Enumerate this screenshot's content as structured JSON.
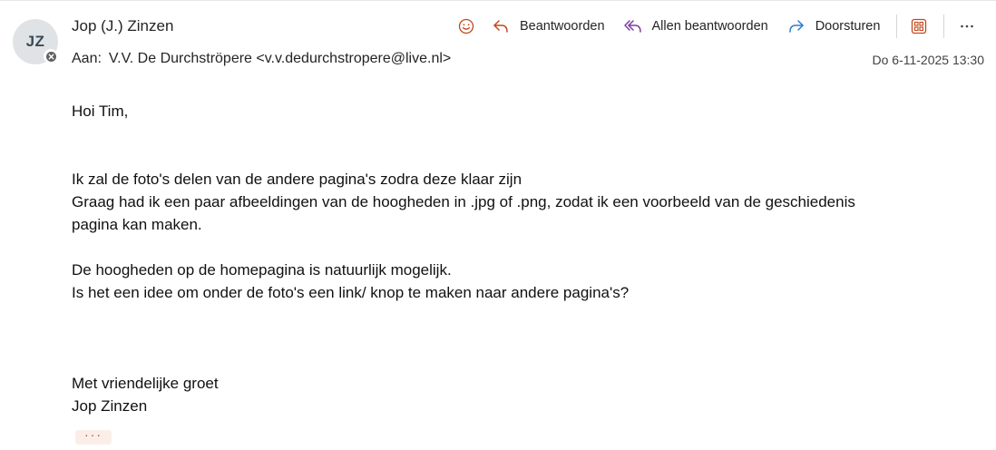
{
  "sender": {
    "initials": "JZ",
    "name": "Jop (J.) Zinzen"
  },
  "recipient": {
    "label": "Aan:",
    "value": "V.V. De Durchströpere <v.v.dedurchstropere@live.nl>"
  },
  "date": "Do 6-11-2025 13:30",
  "toolbar": {
    "reply": "Beantwoorden",
    "reply_all": "Allen beantwoorden",
    "forward": "Doorsturen",
    "more": "···"
  },
  "body": {
    "greeting": "Hoi Tim,",
    "line1": "Ik zal de foto's delen van de andere pagina's zodra deze klaar zijn",
    "line2": "Graag had ik een paar afbeeldingen van de hoogheden in .jpg of .png, zodat ik een voorbeeld van de geschiedenis",
    "line3": "pagina kan maken.",
    "line4": "De hoogheden op de homepagina is natuurlijk mogelijk.",
    "line5": "Is het een idee om onder de foto's een link/ knop te maken naar andere pagina's?",
    "closing": "Met vriendelijke groet",
    "signature": "Jop Zinzen"
  },
  "show_more": "···",
  "colors": {
    "reply_icon": "#c4461d",
    "reply_all_icon": "#7a3ea3",
    "forward_icon": "#2b7bd0",
    "app_icon": "#c4461d"
  },
  "icons": [
    "emoji-icon",
    "reply-icon",
    "reply-all-icon",
    "forward-icon",
    "apps-icon",
    "more-icon",
    "presence-blocked-icon"
  ]
}
